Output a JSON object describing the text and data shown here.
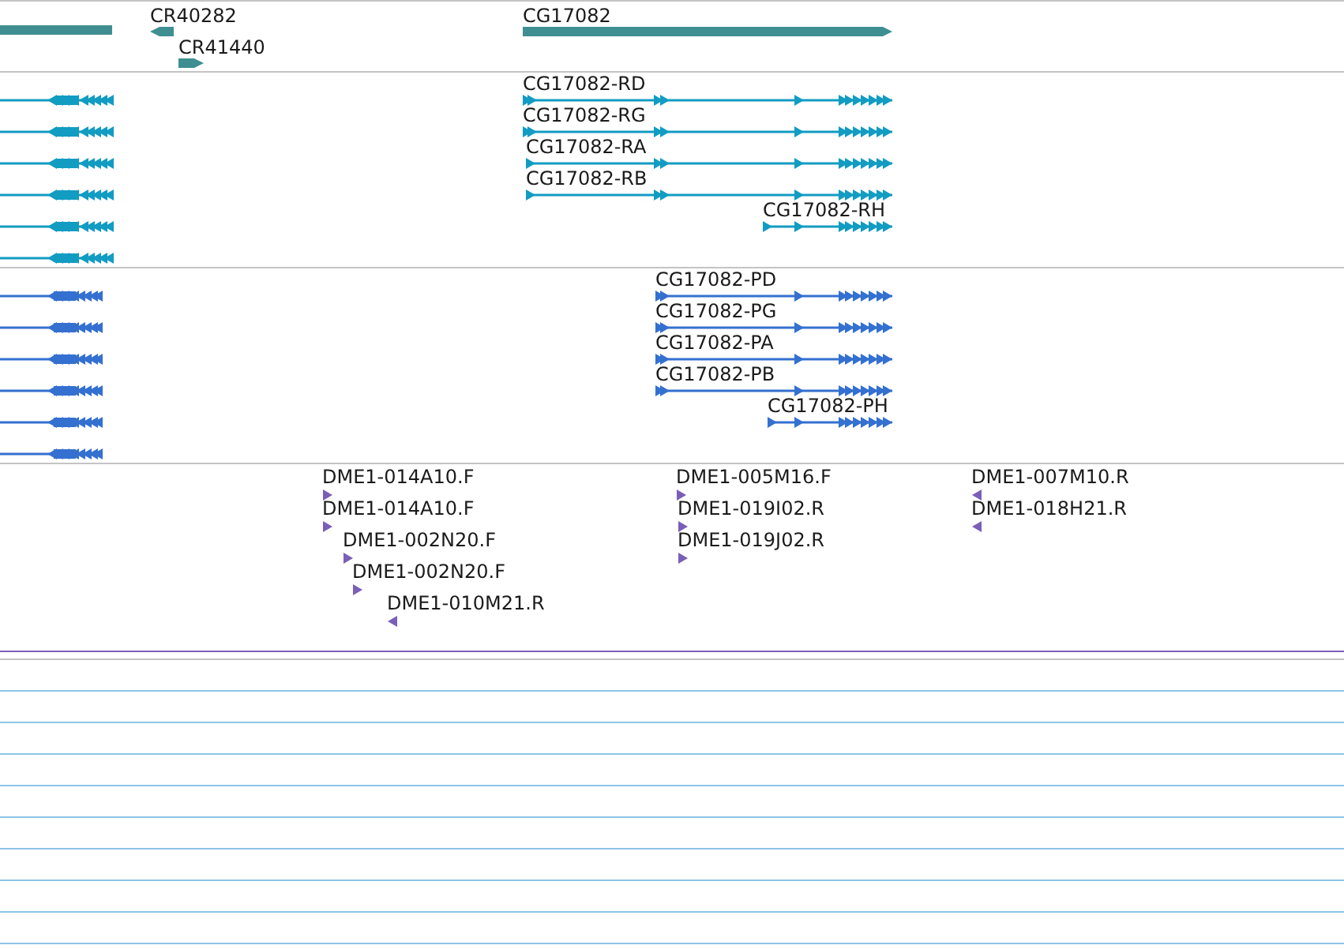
{
  "tracks": [
    {
      "kind": "genes",
      "features": [
        {
          "reverse": true
        },
        {
          "label": "CR40282",
          "reverse": true
        },
        {
          "label": "CR41440",
          "reverse": false
        },
        {
          "label": "CG17082",
          "reverse": false
        }
      ]
    },
    {
      "kind": "transcripts",
      "features": [
        {
          "reverse": true
        },
        {
          "label": "CG17082-RD",
          "reverse": false
        },
        {
          "reverse": true
        },
        {
          "label": "CG17082-RG",
          "reverse": false
        },
        {
          "reverse": true
        },
        {
          "label": "CG17082-RA",
          "reverse": false
        },
        {
          "reverse": true
        },
        {
          "label": "CG17082-RB",
          "reverse": false
        },
        {
          "reverse": true
        },
        {
          "label": "CG17082-RH",
          "reverse": false
        },
        {
          "reverse": true
        }
      ]
    },
    {
      "kind": "proteins",
      "features": [
        {
          "reverse": true
        },
        {
          "label": "CG17082-PD",
          "reverse": false
        },
        {
          "reverse": true
        },
        {
          "label": "CG17082-PG",
          "reverse": false
        },
        {
          "reverse": true
        },
        {
          "label": "CG17082-PA",
          "reverse": false
        },
        {
          "reverse": true
        },
        {
          "label": "CG17082-PB",
          "reverse": false
        },
        {
          "reverse": true
        },
        {
          "label": "CG17082-PH",
          "reverse": false
        },
        {
          "reverse": true
        }
      ]
    },
    {
      "kind": "ests",
      "features": [
        {
          "label": "DME1-014A10.F",
          "reverse": false
        },
        {
          "label": "DME1-005M16.F",
          "reverse": false
        },
        {
          "label": "DME1-007M10.R",
          "reverse": true
        },
        {
          "label": "DME1-014A10.F",
          "reverse": false
        },
        {
          "label": "DME1-019I02.R",
          "reverse": false
        },
        {
          "label": "DME1-018H21.R",
          "reverse": true
        },
        {
          "label": "DME1-002N20.F",
          "reverse": false
        },
        {
          "label": "DME1-019J02.R",
          "reverse": false
        },
        {
          "label": "DME1-002N20.F",
          "reverse": false
        },
        {
          "label": "DME1-010M21.R",
          "reverse": true
        }
      ]
    }
  ]
}
